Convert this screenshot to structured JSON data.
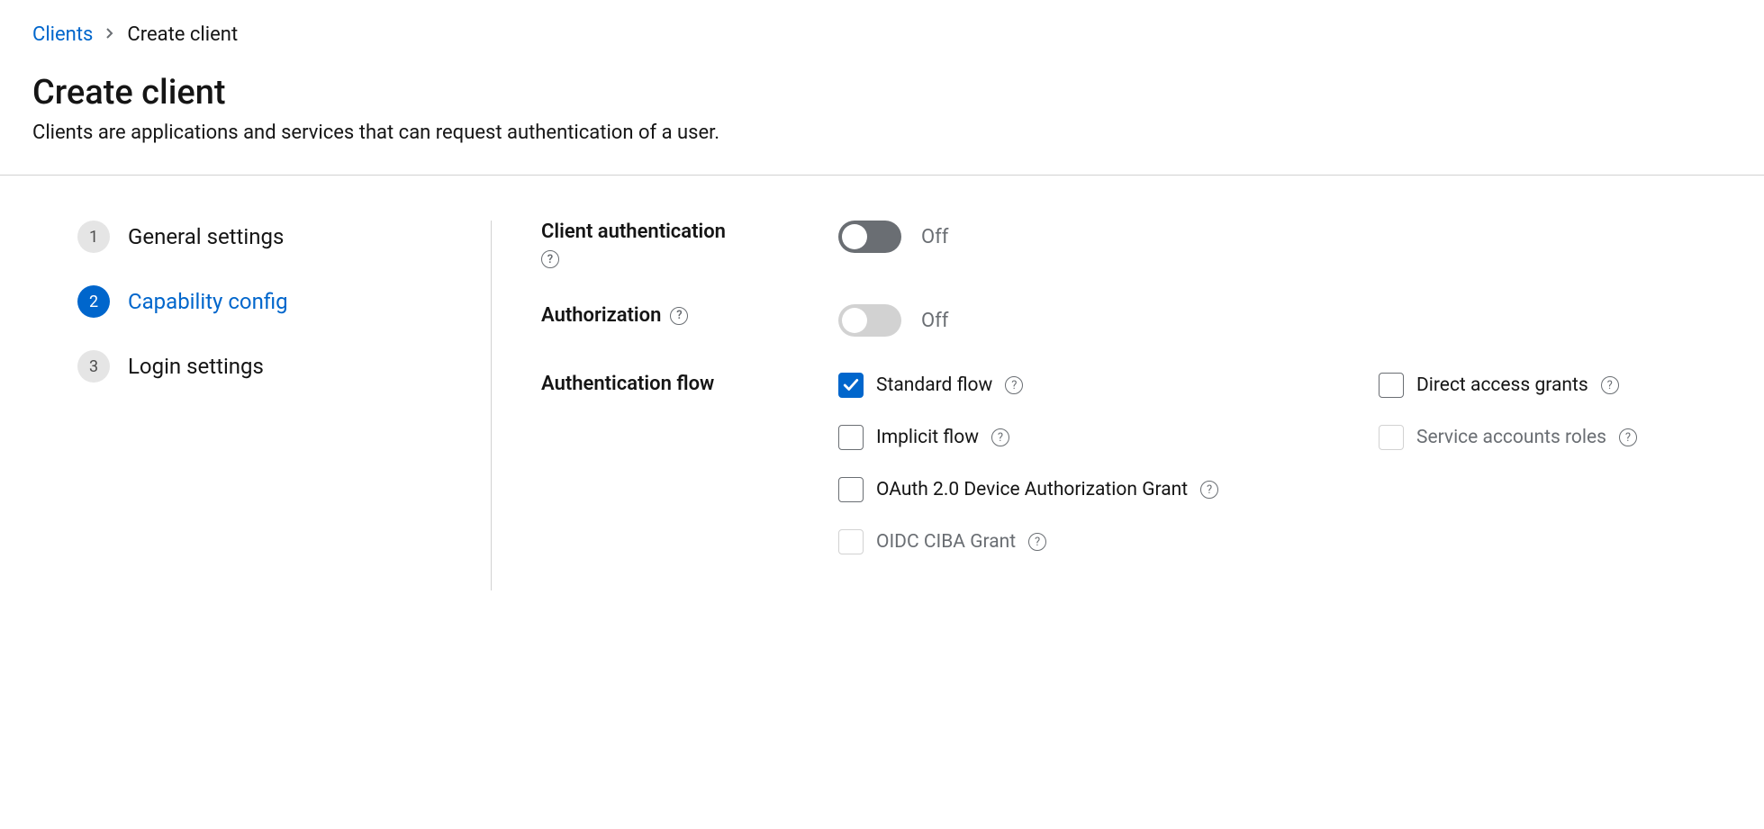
{
  "breadcrumb": {
    "parent": "Clients",
    "current": "Create client"
  },
  "header": {
    "title": "Create client",
    "subtitle": "Clients are applications and services that can request authentication of a user."
  },
  "stepper": {
    "steps": [
      {
        "num": "1",
        "label": "General settings",
        "active": false
      },
      {
        "num": "2",
        "label": "Capability config",
        "active": true
      },
      {
        "num": "3",
        "label": "Login settings",
        "active": false
      }
    ]
  },
  "form": {
    "client_auth": {
      "label": "Client authentication",
      "state": "Off"
    },
    "authorization": {
      "label": "Authorization",
      "state": "Off"
    },
    "auth_flow": {
      "label": "Authentication flow",
      "options": {
        "standard": "Standard flow",
        "direct_access": "Direct access grants",
        "implicit": "Implicit flow",
        "service_accounts": "Service accounts roles",
        "device": "OAuth 2.0 Device Authorization Grant",
        "ciba": "OIDC CIBA Grant"
      }
    }
  }
}
